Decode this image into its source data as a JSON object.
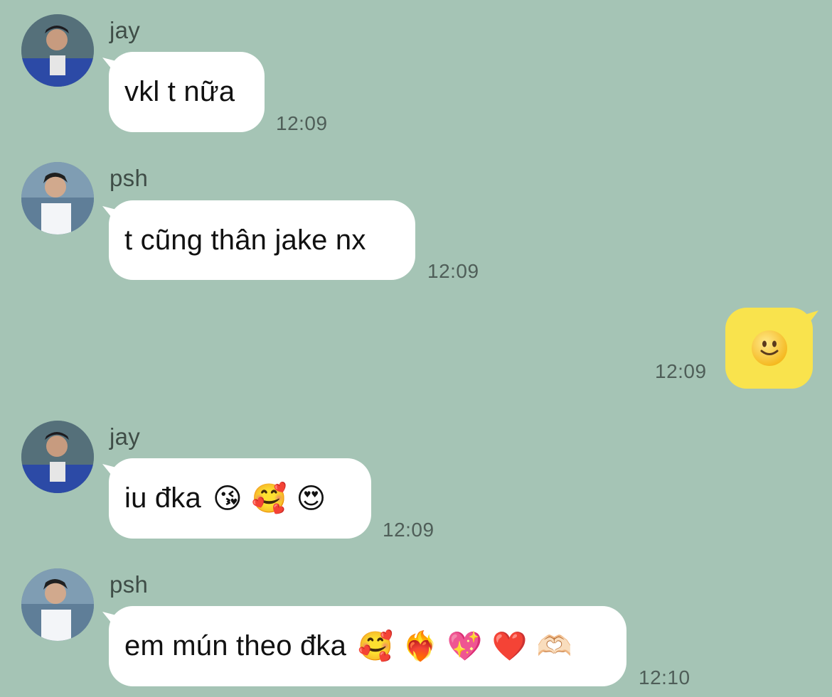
{
  "colors": {
    "background": "#a5c4b5",
    "incoming_bubble": "#ffffff",
    "outgoing_bubble": "#f9e34d",
    "timestamp": "#4f5e58"
  },
  "messages": [
    {
      "sender": "jay",
      "avatar_icon": "jay-avatar-icon",
      "text": "vkl t nữa",
      "time": "12:09"
    },
    {
      "sender": "psh",
      "avatar_icon": "psh-avatar-icon",
      "text": "t cũng thân jake nx",
      "time": "12:09"
    },
    {
      "sender": "me",
      "sticker_icon": "slightly-smiling-face-icon",
      "time": "12:09"
    },
    {
      "sender": "jay",
      "avatar_icon": "jay-avatar-icon",
      "text": "iu đka",
      "emojis": "😘 🥰 😍",
      "time": "12:09"
    },
    {
      "sender": "psh",
      "avatar_icon": "psh-avatar-icon",
      "text": "em mún theo đka",
      "emojis": "🥰 ❤️‍🔥 💖 ❤️ 🫶🏻",
      "time": "12:10"
    }
  ]
}
